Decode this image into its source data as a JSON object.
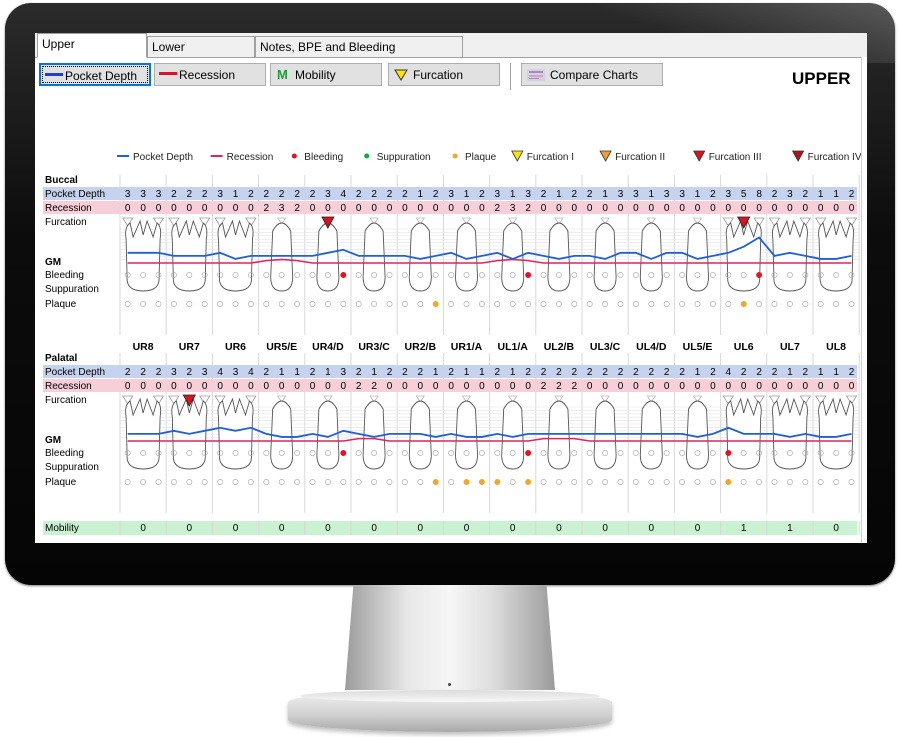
{
  "tabs": [
    {
      "label": "Upper",
      "active": true
    },
    {
      "label": "Lower",
      "active": false
    },
    {
      "label": "Notes, BPE and Bleeding",
      "active": false
    }
  ],
  "toolbar": {
    "pocket_depth": "Pocket Depth",
    "recession": "Recession",
    "mobility": "Mobility",
    "mobility_glyph": "M",
    "furcation": "Furcation",
    "compare": "Compare Charts"
  },
  "page_title": "UPPER",
  "legend": [
    {
      "label": "Pocket Depth",
      "kind": "line",
      "color": "#1f5fd9"
    },
    {
      "label": "Recession",
      "kind": "line",
      "color": "#e0245e"
    },
    {
      "label": "Bleeding",
      "kind": "dot",
      "color": "#e81123"
    },
    {
      "label": "Suppuration",
      "kind": "dot",
      "color": "#1aa34a"
    },
    {
      "label": "Plaque",
      "kind": "dot",
      "color": "#f5a623"
    },
    {
      "label": "Furcation I",
      "kind": "tri",
      "color": "#ffe500"
    },
    {
      "label": "Furcation II",
      "kind": "tri",
      "color": "#f0a030"
    },
    {
      "label": "Furcation III",
      "kind": "tri",
      "color": "#d9141e"
    },
    {
      "label": "Furcation IV",
      "kind": "tri",
      "color": "#b0141a"
    }
  ],
  "colors": {
    "pocket": "#1f5fd9",
    "recession": "#e0245e",
    "pd_row": "#c6d3ee",
    "rec_row": "#f6cfd8",
    "mob_row": "#c9f1d2"
  },
  "teeth": [
    "UR8",
    "UR7",
    "UR6",
    "UR5/E",
    "UR4/D",
    "UR3/C",
    "UR2/B",
    "UR1/A",
    "UL1/A",
    "UL2/B",
    "UL3/C",
    "UL4/D",
    "UL5/E",
    "UL6",
    "UL7",
    "UL8"
  ],
  "buccal": {
    "section": "Buccal",
    "labels": {
      "pd": "Pocket Depth",
      "rec": "Recession",
      "furc": "Furcation",
      "gm": "GM",
      "bleed": "Bleeding",
      "supp": "Suppuration",
      "plaque": "Plaque"
    },
    "pocket_depth": [
      3,
      3,
      3,
      2,
      2,
      2,
      3,
      1,
      2,
      2,
      2,
      2,
      2,
      3,
      4,
      2,
      2,
      2,
      2,
      1,
      2,
      3,
      1,
      2,
      3,
      1,
      3,
      2,
      1,
      2,
      2,
      1,
      3,
      3,
      1,
      3,
      3,
      1,
      2,
      3,
      5,
      8,
      2,
      3,
      2,
      1,
      1,
      2
    ],
    "recession": [
      0,
      0,
      0,
      0,
      0,
      0,
      0,
      0,
      0,
      2,
      3,
      2,
      0,
      0,
      0,
      0,
      0,
      0,
      0,
      0,
      0,
      0,
      0,
      0,
      2,
      3,
      2,
      0,
      0,
      0,
      0,
      0,
      0,
      0,
      0,
      0,
      0,
      0,
      0,
      0,
      0,
      0,
      0,
      0,
      0,
      0,
      0,
      0
    ],
    "furcation_marks": [
      {
        "tooth": 4,
        "grade": "III"
      },
      {
        "tooth": 13,
        "grade": "III"
      }
    ],
    "bleeding_sites": [
      14,
      26,
      41
    ],
    "plaque_sites": [
      20,
      40
    ]
  },
  "palatal": {
    "section": "Palatal",
    "labels": {
      "pd": "Pocket Depth",
      "rec": "Recession",
      "furc": "Furcation",
      "gm": "GM",
      "bleed": "Bleeding",
      "supp": "Suppuration",
      "plaque": "Plaque"
    },
    "pocket_depth": [
      2,
      2,
      2,
      3,
      2,
      3,
      4,
      3,
      4,
      2,
      1,
      1,
      2,
      1,
      3,
      2,
      1,
      2,
      2,
      2,
      1,
      2,
      1,
      1,
      2,
      1,
      2,
      2,
      2,
      2,
      2,
      2,
      2,
      2,
      2,
      2,
      2,
      1,
      2,
      4,
      2,
      2,
      2,
      1,
      2,
      1,
      1,
      2
    ],
    "recession": [
      0,
      0,
      0,
      0,
      0,
      0,
      0,
      0,
      0,
      0,
      0,
      0,
      0,
      0,
      0,
      2,
      2,
      0,
      0,
      0,
      0,
      0,
      0,
      0,
      0,
      0,
      0,
      2,
      2,
      2,
      0,
      0,
      0,
      0,
      0,
      0,
      0,
      0,
      0,
      0,
      0,
      0,
      0,
      0,
      0,
      0,
      0,
      0
    ],
    "furcation_marks": [
      {
        "tooth": 1,
        "grade": "III"
      }
    ],
    "bleeding_sites": [
      14,
      26,
      39
    ],
    "plaque_sites": [
      20,
      22,
      23,
      24,
      26,
      39
    ]
  },
  "mobility": {
    "label": "Mobility",
    "values": [
      0,
      0,
      0,
      0,
      0,
      0,
      0,
      0,
      0,
      0,
      0,
      0,
      0,
      1,
      1,
      0
    ]
  }
}
